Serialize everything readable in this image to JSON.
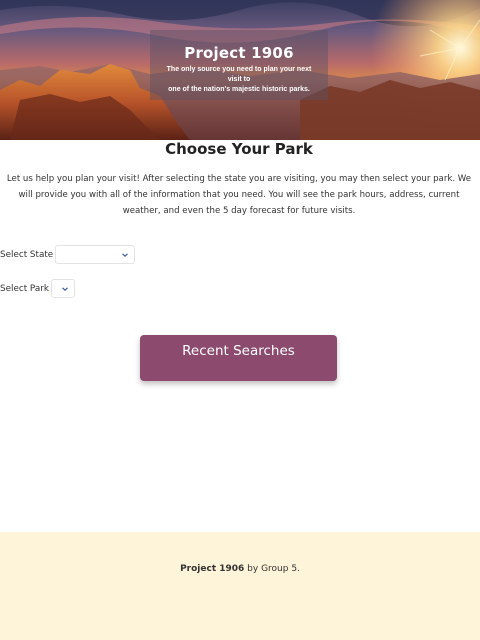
{
  "hero": {
    "title": "Project 1906",
    "subtitle_line1": "The only source you need to plan your next",
    "subtitle_line2": "visit to",
    "subtitle_line3": "one of the nation's majestic historic parks.",
    "image_icon": "grand-canyon-sunset-image"
  },
  "main": {
    "heading": "Choose Your Park",
    "intro": "Let us help you plan your visit! After selecting the state you are visiting, you may then select your park. We will provide you with all of the information that you need. You will see the park hours, address, current weather, and even the 5 day forecast for future visits."
  },
  "form": {
    "state_label": "Select State",
    "state_value": "",
    "park_label": "Select Park",
    "park_value": ""
  },
  "recent_button": {
    "label": "Recent Searches",
    "color": "#8b4a6e"
  },
  "footer": {
    "brand": "Project 1906",
    "suffix": " by Group 5.",
    "background": "#fdf4d9"
  }
}
